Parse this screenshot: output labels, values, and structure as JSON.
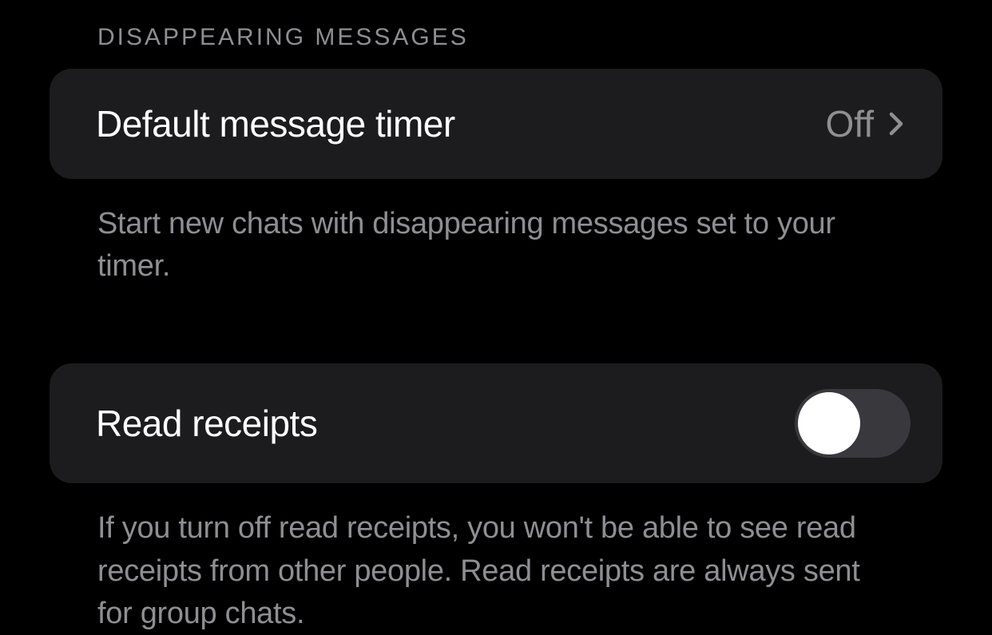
{
  "section1": {
    "header": "DISAPPEARING MESSAGES",
    "item": {
      "label": "Default message timer",
      "value": "Off"
    },
    "description": "Start new chats with disappearing messages set to your timer."
  },
  "section2": {
    "item": {
      "label": "Read receipts",
      "toggle_state": "off"
    },
    "description": "If you turn off read receipts, you won't be able to see read receipts from other people. Read receipts are always sent for group chats."
  }
}
